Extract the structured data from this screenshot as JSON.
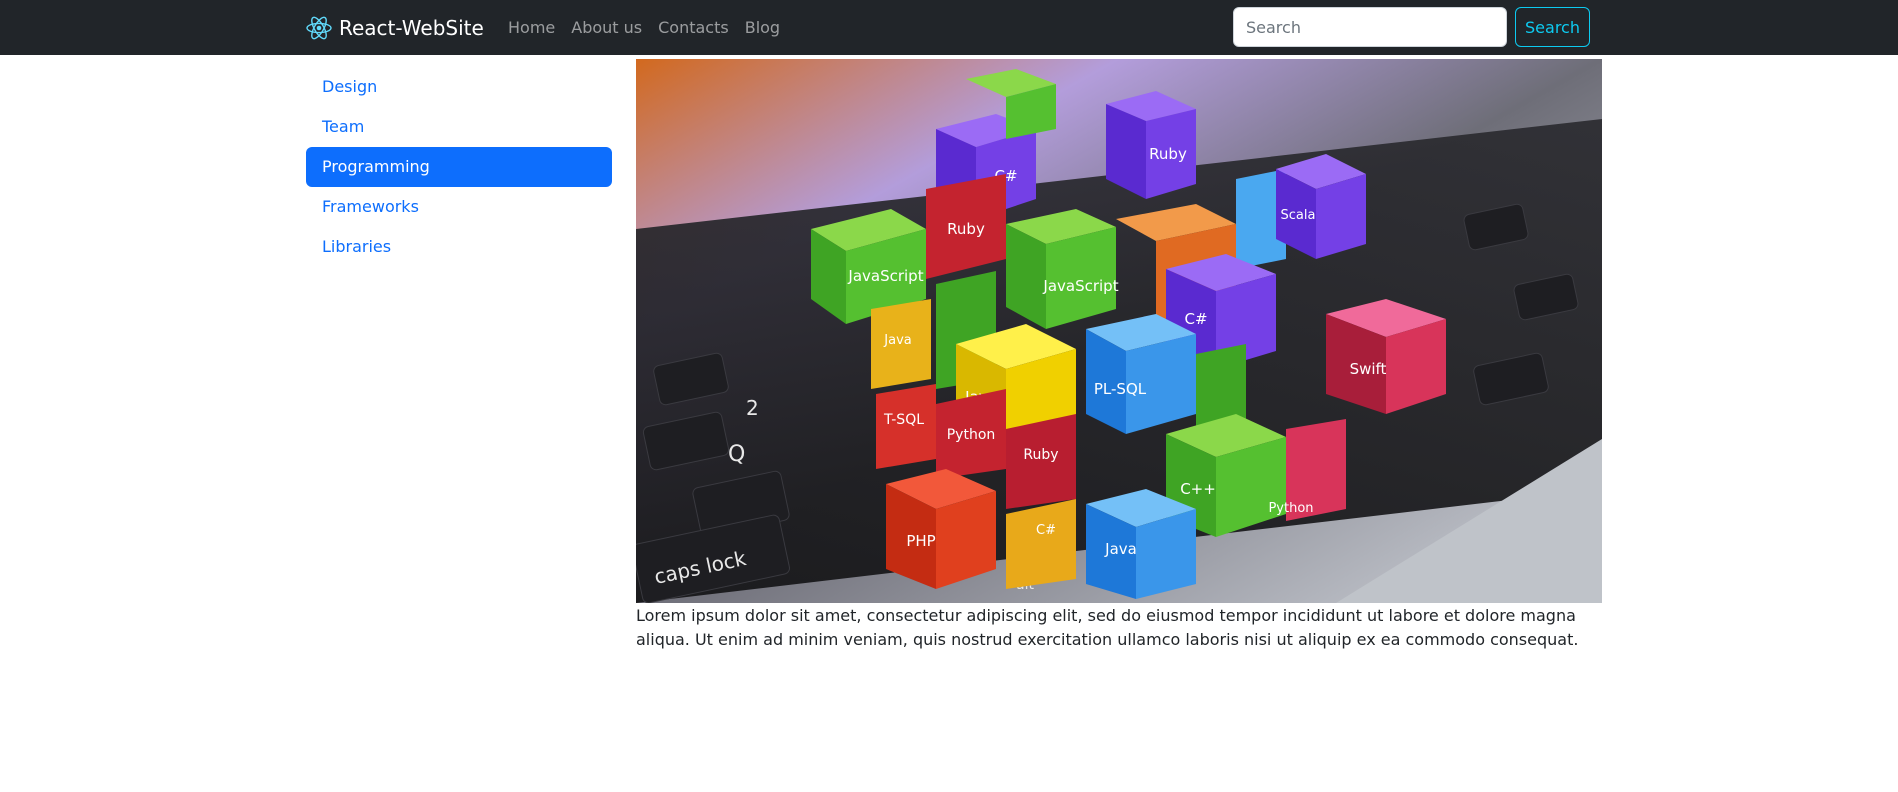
{
  "navbar": {
    "brand": "React-WebSite",
    "brand_icon": "react-logo-icon",
    "links": [
      "Home",
      "About us",
      "Contacts",
      "Blog"
    ],
    "search_placeholder": "Search",
    "search_button": "Search"
  },
  "sidebar": {
    "items": [
      {
        "label": "Design",
        "active": false
      },
      {
        "label": "Team",
        "active": false
      },
      {
        "label": "Programming",
        "active": true
      },
      {
        "label": "Frameworks",
        "active": false
      },
      {
        "label": "Libraries",
        "active": false
      }
    ]
  },
  "hero": {
    "cube_labels": [
      "JavaScript",
      "C#",
      "Ruby",
      "Java",
      "PL-SQL",
      "T-SQL",
      "Python",
      "PHP",
      "C++",
      "Swift",
      "Scala"
    ],
    "key_labels": [
      "caps lock",
      "Q",
      "2",
      "alt"
    ]
  },
  "content": {
    "text": "Lorem ipsum dolor sit amet, consectetur adipiscing elit, sed do eiusmod tempor incididunt ut labore et dolore magna aliqua. Ut enim ad minim veniam, quis nostrud exercitation ullamco laboris nisi ut aliquip ex ea commodo consequat."
  },
  "colors": {
    "navbar_bg": "#212529",
    "primary": "#0d6efd",
    "search_button": "#0dcaf0"
  }
}
